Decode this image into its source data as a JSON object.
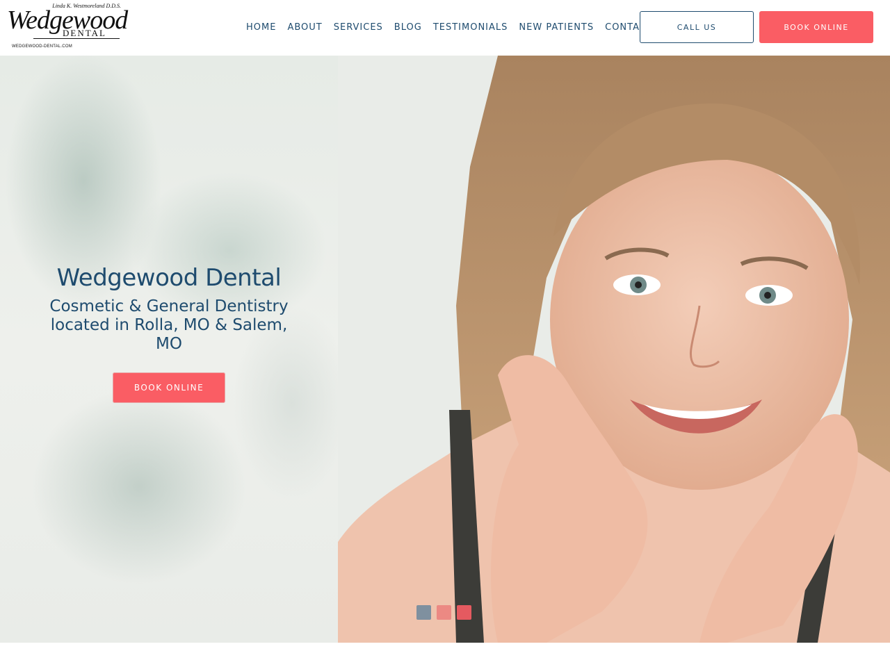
{
  "header": {
    "logo": {
      "doctor": "Linda K. Westmoreland D.D.S.",
      "brand": "Wedgewood",
      "sub": "DENTAL",
      "url": "WEDGEWOOD-DENTAL.COM"
    },
    "nav": [
      "HOME",
      "ABOUT",
      "SERVICES",
      "BLOG",
      "TESTIMONIALS",
      "NEW PATIENTS",
      "CONTACT"
    ],
    "call_label": "CALL US",
    "book_label": "BOOK ONLINE"
  },
  "hero": {
    "title": "Wedgewood Dental",
    "subtitle": "Cosmetic & General Dentistry located in Rolla, MO & Salem, MO",
    "book_label": "BOOK ONLINE",
    "slides": [
      {
        "color": "#7f909f"
      },
      {
        "color": "#ec8983"
      },
      {
        "color": "#e55a60"
      }
    ]
  },
  "colors": {
    "accent": "#fa5d64",
    "brand_blue": "#1e4b6e"
  }
}
